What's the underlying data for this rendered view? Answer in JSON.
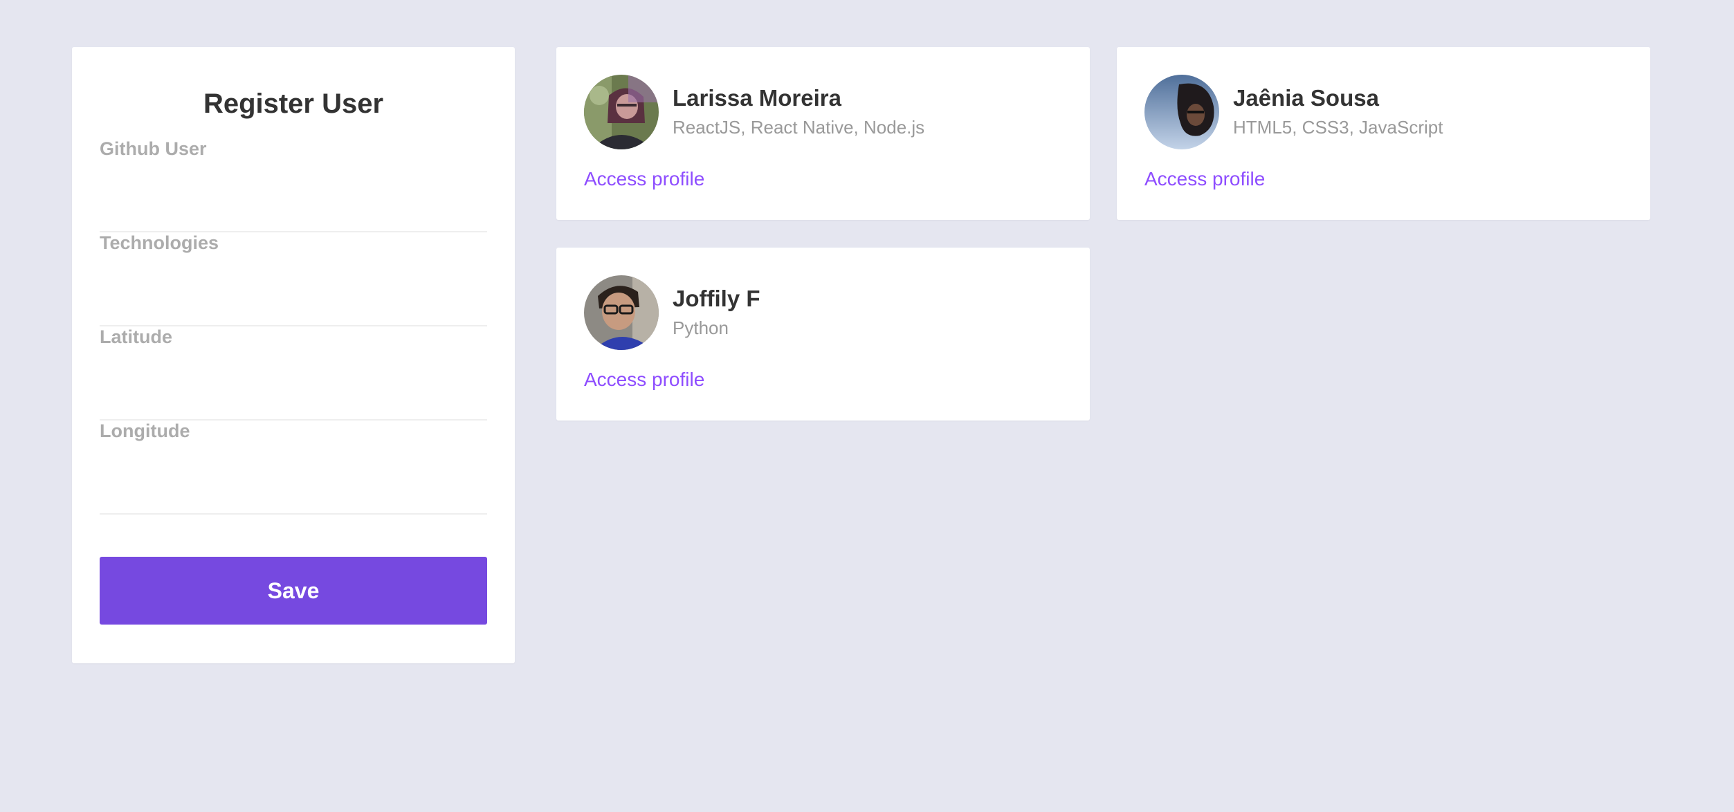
{
  "register": {
    "title": "Register User",
    "fields": [
      {
        "label": "Github User",
        "value": ""
      },
      {
        "label": "Technologies",
        "value": ""
      },
      {
        "label": "Latitude",
        "value": ""
      },
      {
        "label": "Longitude",
        "value": ""
      }
    ],
    "save_label": "Save"
  },
  "devs": [
    {
      "name": "Larissa Moreira",
      "techs": "ReactJS, React Native, Node.js",
      "link_label": "Access profile"
    },
    {
      "name": "Jaênia Sousa",
      "techs": "HTML5, CSS3, JavaScript",
      "link_label": "Access profile"
    },
    {
      "name": "Joffily F",
      "techs": "Python",
      "link_label": "Access profile"
    }
  ],
  "colors": {
    "background": "#e5e6f0",
    "accent": "#7649e0",
    "link": "#8e4dff"
  }
}
